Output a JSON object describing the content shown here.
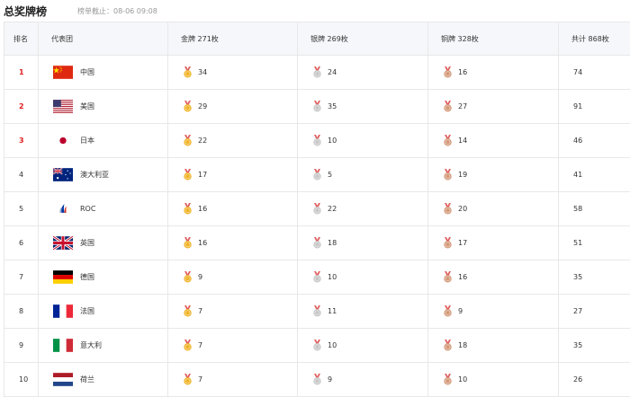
{
  "header": {
    "title": "总奖牌榜",
    "updated": "榜单截止：08-06 09:08"
  },
  "columns": {
    "rank": "排名",
    "team": "代表团",
    "gold": "金牌 271枚",
    "silver": "银牌 269枚",
    "bronze": "铜牌 328枚",
    "total": "共计 868枚"
  },
  "colors": {
    "gold": "#f0b429",
    "silver": "#c8c8c8",
    "bronze": "#d49a7a",
    "top_rank": "#e02020"
  },
  "rows": [
    {
      "rank": "1",
      "country": "中国",
      "flag": "cn-flag-icon",
      "gold": "34",
      "silver": "24",
      "bronze": "16",
      "total": "74"
    },
    {
      "rank": "2",
      "country": "美国",
      "flag": "us-flag-icon",
      "gold": "29",
      "silver": "35",
      "bronze": "27",
      "total": "91"
    },
    {
      "rank": "3",
      "country": "日本",
      "flag": "jp-flag-icon",
      "gold": "22",
      "silver": "10",
      "bronze": "14",
      "total": "46"
    },
    {
      "rank": "4",
      "country": "澳大利亚",
      "flag": "au-flag-icon",
      "gold": "17",
      "silver": "5",
      "bronze": "19",
      "total": "41"
    },
    {
      "rank": "5",
      "country": "ROC",
      "flag": "roc-emblem-icon",
      "gold": "16",
      "silver": "22",
      "bronze": "20",
      "total": "58"
    },
    {
      "rank": "6",
      "country": "英国",
      "flag": "gb-flag-icon",
      "gold": "16",
      "silver": "18",
      "bronze": "17",
      "total": "51"
    },
    {
      "rank": "7",
      "country": "德国",
      "flag": "de-flag-icon",
      "gold": "9",
      "silver": "10",
      "bronze": "16",
      "total": "35"
    },
    {
      "rank": "8",
      "country": "法国",
      "flag": "fr-flag-icon",
      "gold": "7",
      "silver": "11",
      "bronze": "9",
      "total": "27"
    },
    {
      "rank": "9",
      "country": "意大利",
      "flag": "it-flag-icon",
      "gold": "7",
      "silver": "10",
      "bronze": "18",
      "total": "35"
    },
    {
      "rank": "10",
      "country": "荷兰",
      "flag": "nl-flag-icon",
      "gold": "7",
      "silver": "9",
      "bronze": "10",
      "total": "26"
    }
  ]
}
